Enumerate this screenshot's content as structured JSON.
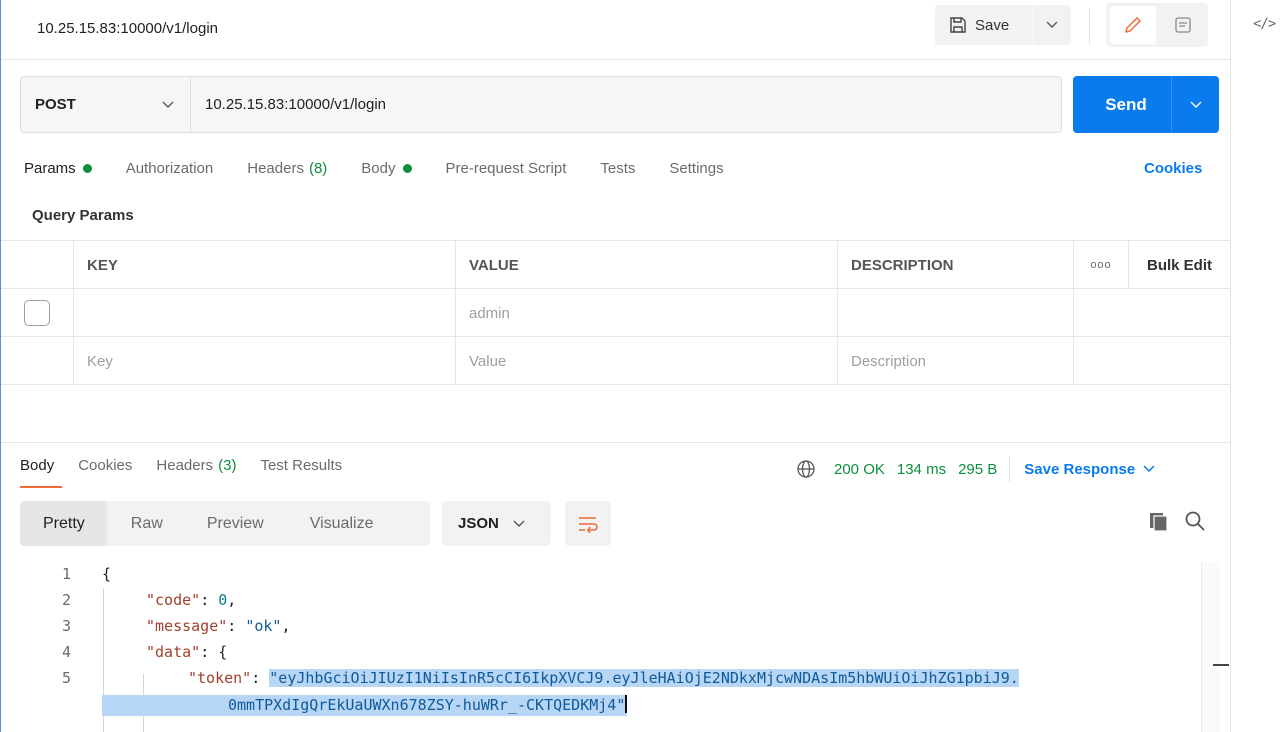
{
  "header": {
    "title": "10.25.15.83:10000/v1/login",
    "save_label": "Save"
  },
  "request": {
    "method": "POST",
    "url": "10.25.15.83:10000/v1/login",
    "send_label": "Send"
  },
  "request_tabs": [
    {
      "label": "Params",
      "dot": true,
      "active": true
    },
    {
      "label": "Authorization"
    },
    {
      "label": "Headers",
      "count": "(8)"
    },
    {
      "label": "Body",
      "dot": true
    },
    {
      "label": "Pre-request Script"
    },
    {
      "label": "Tests"
    },
    {
      "label": "Settings"
    }
  ],
  "cookies_label": "Cookies",
  "query_params": {
    "title": "Query Params",
    "columns": {
      "key": "KEY",
      "value": "VALUE",
      "description": "DESCRIPTION",
      "more": "ooo",
      "bulk_edit": "Bulk Edit"
    },
    "rows": [
      {
        "key": "",
        "value": "admin",
        "description": ""
      }
    ],
    "placeholders": {
      "key": "Key",
      "value": "Value",
      "description": "Description"
    }
  },
  "response": {
    "tabs": [
      {
        "label": "Body",
        "active": true
      },
      {
        "label": "Cookies"
      },
      {
        "label": "Headers",
        "count": "(3)"
      },
      {
        "label": "Test Results"
      }
    ],
    "status": "200 OK",
    "time": "134 ms",
    "size": "295 B",
    "save_response_label": "Save Response",
    "views": [
      "Pretty",
      "Raw",
      "Preview",
      "Visualize"
    ],
    "format": "JSON",
    "code": {
      "line_numbers": [
        "1",
        "2",
        "3",
        "4",
        "5"
      ],
      "open_brace": "{",
      "code_key": "\"code\"",
      "code_val": "0",
      "message_key": "\"message\"",
      "message_val": "\"ok\"",
      "data_key": "\"data\"",
      "token_key": "\"token\"",
      "token_part1": "\"eyJhbGciOiJIUzI1NiIsInR5cCI6IkpXVCJ9.eyJleHAiOjE2NDkxMjcwNDAsIm5hbWUiOiJhZG1pbiJ9.",
      "token_part2": "0mmTPXdIgQrEkUaUWXn678ZSY-huWRr_-CKTQEDKMj4\""
    }
  },
  "colors": {
    "accent": "#097bed",
    "success": "#0c8f3e",
    "active_tab_underline": "#f26b3a"
  }
}
